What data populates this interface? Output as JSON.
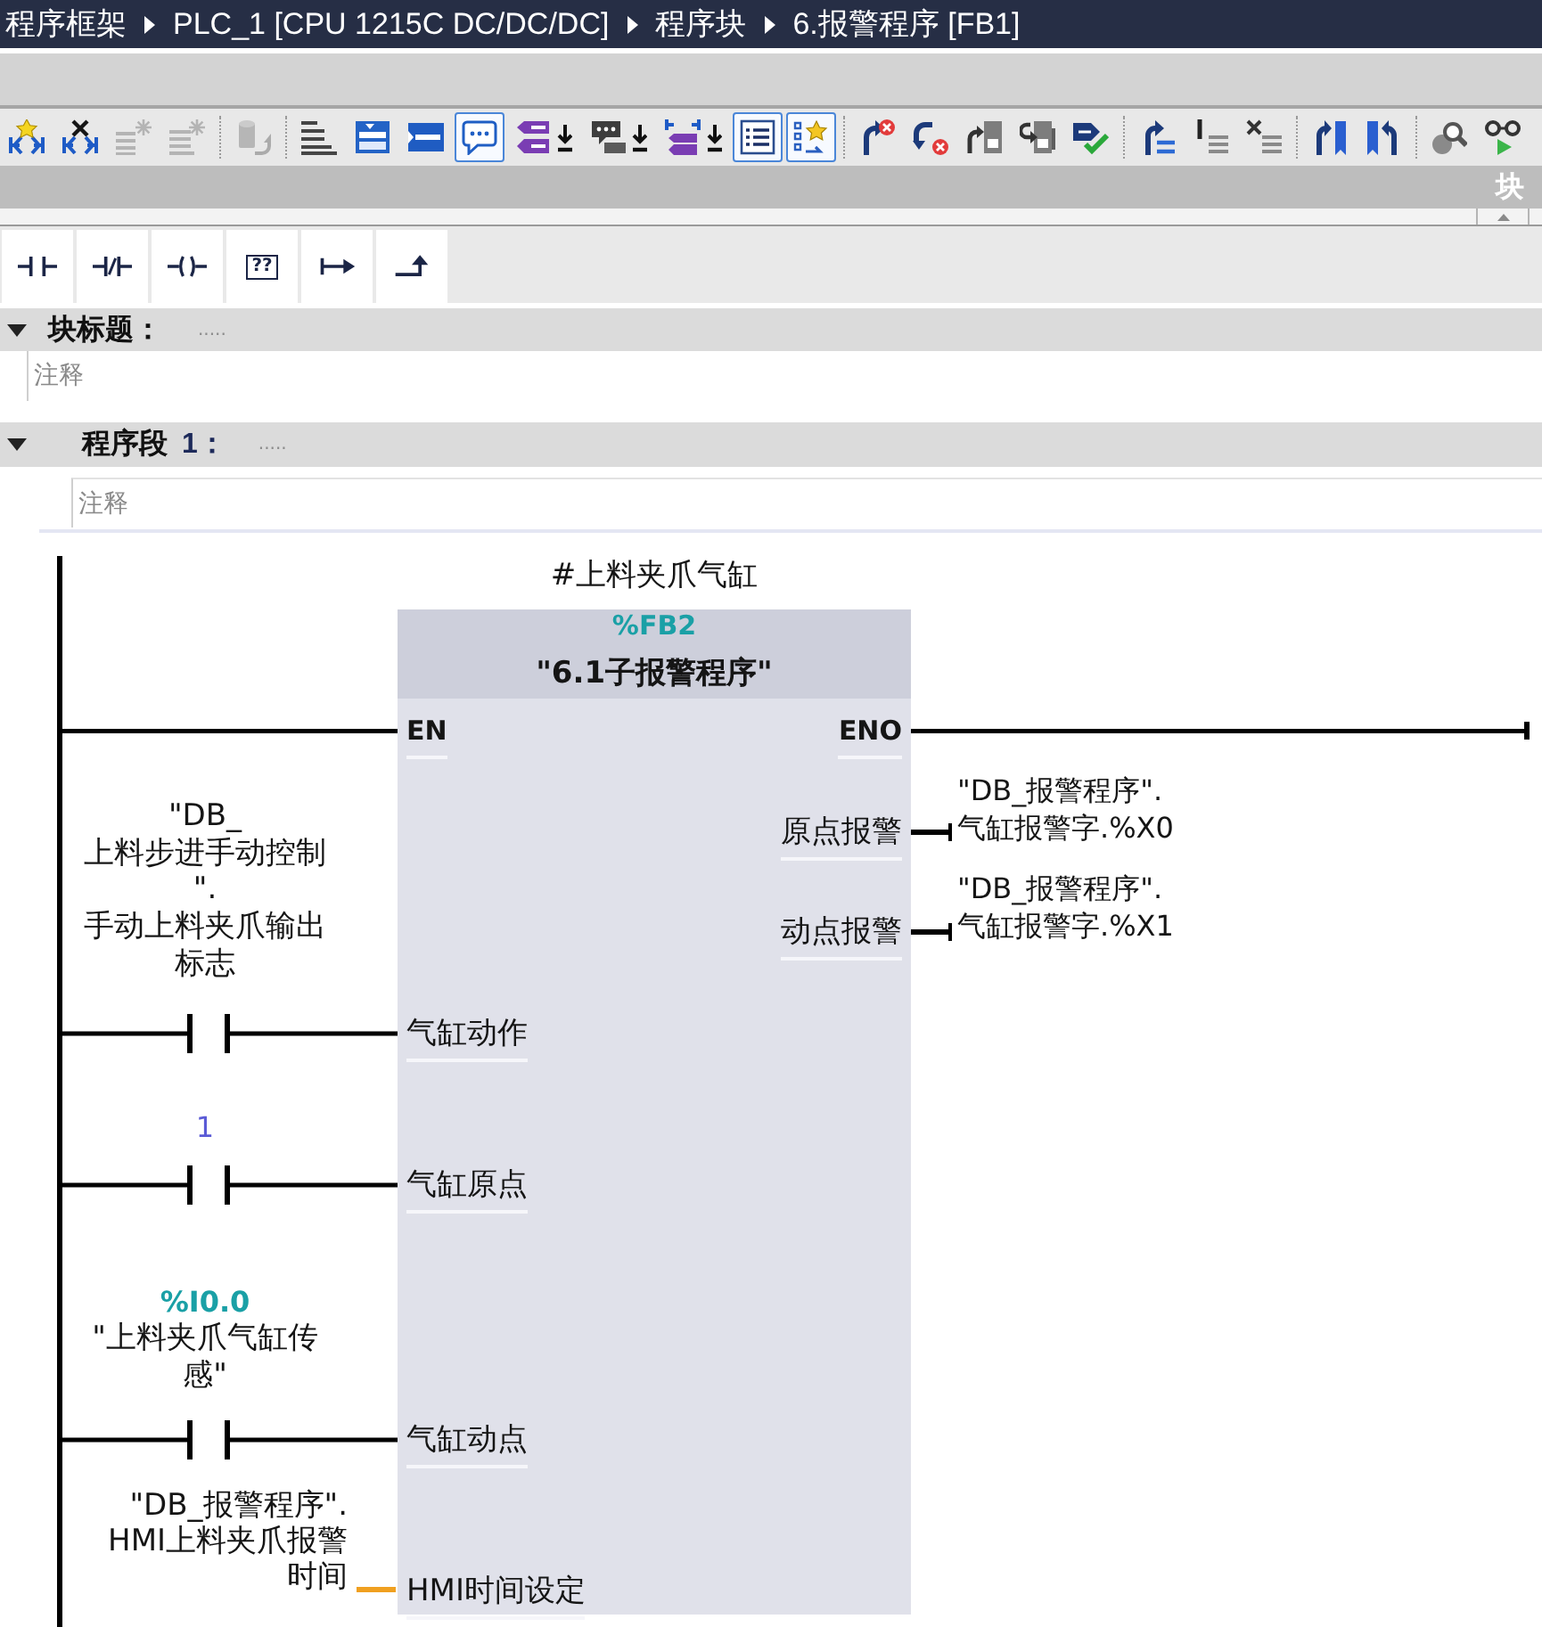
{
  "breadcrumb": [
    "程序框架",
    "PLC_1 [CPU 1215C DC/DC/DC]",
    "程序块",
    "6.报警程序 [FB1]"
  ],
  "toolbar": {
    "groups": [
      [
        {
          "kind": "add",
          "selected": false,
          "disabled": false
        },
        {
          "kind": "delete",
          "selected": false,
          "disabled": false
        },
        {
          "kind": "rowsa",
          "selected": false,
          "disabled": true
        },
        {
          "kind": "rowsb",
          "selected": false,
          "disabled": true
        }
      ],
      [
        {
          "kind": "restore",
          "selected": false,
          "disabled": true
        }
      ],
      [
        {
          "kind": "stairs",
          "selected": false,
          "disabled": false
        },
        {
          "kind": "window",
          "selected": false,
          "disabled": false
        },
        {
          "kind": "panel",
          "selected": false,
          "disabled": false
        },
        {
          "kind": "bubble",
          "selected": true,
          "disabled": false
        },
        {
          "kind": "tagarrow",
          "selected": false,
          "disabled": false
        },
        {
          "kind": "bubblearrow",
          "selected": false,
          "disabled": false
        },
        {
          "kind": "netarrow",
          "selected": false,
          "disabled": false
        },
        {
          "kind": "list",
          "selected": true,
          "disabled": false
        },
        {
          "kind": "favorites",
          "selected": true,
          "disabled": false
        }
      ],
      [
        {
          "kind": "errnext",
          "selected": false,
          "disabled": false
        },
        {
          "kind": "errprev",
          "selected": false,
          "disabled": false
        },
        {
          "kind": "modnext",
          "selected": false,
          "disabled": false
        },
        {
          "kind": "modprev",
          "selected": false,
          "disabled": false
        },
        {
          "kind": "check",
          "selected": false,
          "disabled": false
        }
      ],
      [
        {
          "kind": "jumplines",
          "selected": false,
          "disabled": false
        },
        {
          "kind": "barsa",
          "selected": false,
          "disabled": false
        },
        {
          "kind": "barsb",
          "selected": false,
          "disabled": false
        }
      ],
      [
        {
          "kind": "bookprev",
          "selected": false,
          "disabled": false
        },
        {
          "kind": "booknext",
          "selected": false,
          "disabled": false
        }
      ],
      [
        {
          "kind": "inspect",
          "selected": false,
          "disabled": false
        },
        {
          "kind": "monitor",
          "selected": false,
          "disabled": false
        }
      ]
    ]
  },
  "interface_bar": {
    "title": "块"
  },
  "instructions": [
    {
      "kind": "contact"
    },
    {
      "kind": "negated"
    },
    {
      "kind": "coil"
    },
    {
      "kind": "box",
      "label": "??"
    },
    {
      "kind": "branch"
    },
    {
      "kind": "close"
    }
  ],
  "block_title": {
    "label": "块标题：",
    "expanded": true,
    "title_field": {
      "placeholder": "....."
    },
    "comment_field": {
      "placeholder": "注释"
    }
  },
  "network": {
    "label": "程序段",
    "number": "1：",
    "expanded": true,
    "title_field": {
      "placeholder": "....."
    },
    "comment_field": {
      "placeholder": "注释"
    },
    "ladder": {
      "instance": "#上料夹爪气缸",
      "block": {
        "address": "%FB2",
        "name": "\"6.1子报警程序\""
      },
      "en": "EN",
      "eno": "ENO",
      "inputs": [
        {
          "kind": "contact",
          "pin": "气缸动作",
          "operand": [
            "\"DB_",
            "上料步进手动控制",
            "\".",
            "手动上料夹爪输出",
            "标志"
          ]
        },
        {
          "kind": "contact",
          "pin": "气缸原点",
          "constant": "1"
        },
        {
          "kind": "contact",
          "pin": "气缸动点",
          "address": "%I0.0",
          "operand": [
            "\"上料夹爪气缸传",
            "感\""
          ]
        },
        {
          "kind": "value",
          "pin": "HMI时间设定",
          "operand": [
            "\"DB_报警程序\".",
            "HMI上料夹爪报警",
            "时间"
          ]
        }
      ],
      "outputs": [
        {
          "pin": "原点报警",
          "operand": [
            "\"DB_报警程序\".",
            "气缸报警字.%X0"
          ]
        },
        {
          "pin": "动点报警",
          "operand": [
            "\"DB_报警程序\".",
            "气缸报警字.%X1"
          ]
        }
      ]
    }
  }
}
